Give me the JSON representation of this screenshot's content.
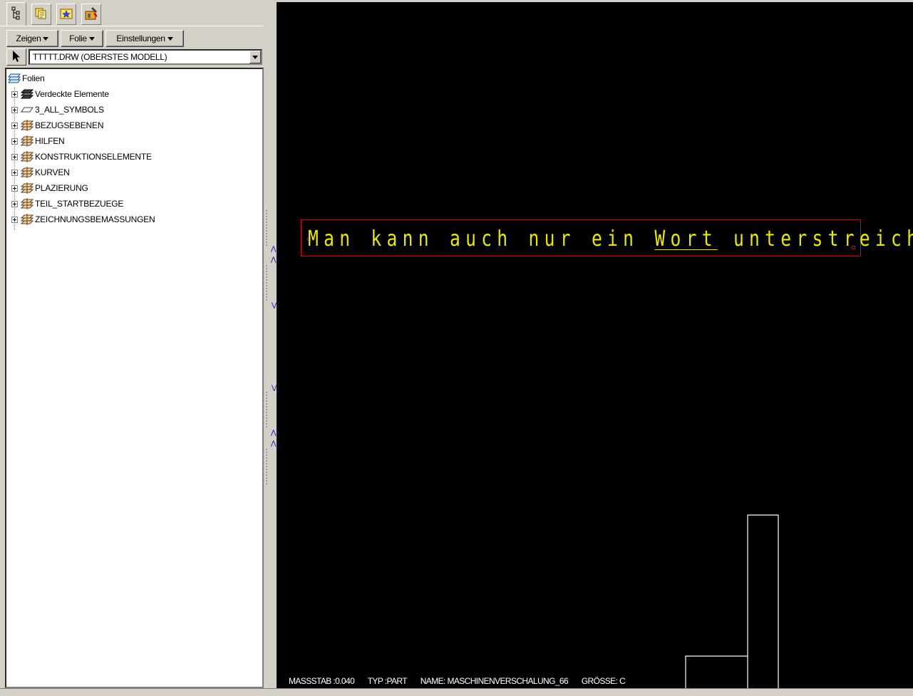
{
  "toolbar_tabs": [
    {
      "icon": "model-tree-icon"
    },
    {
      "icon": "folder-pages-icon"
    },
    {
      "icon": "favorites-star-icon"
    },
    {
      "icon": "toolbox-icon"
    }
  ],
  "menus": {
    "zeigen": "Zeigen",
    "folie": "Folie",
    "einstellungen": "Einstellungen"
  },
  "model_select": {
    "value": "TTTTT.DRW (OBERSTES MODELL)"
  },
  "tree": {
    "root": "Folien",
    "items": [
      {
        "label": "Verdeckte Elemente",
        "icon": "hidden-layers-icon"
      },
      {
        "label": "3_ALL_SYMBOLS",
        "icon": "plane-layer-icon"
      },
      {
        "label": "BEZUGSEBENEN",
        "icon": "layer-stack-icon"
      },
      {
        "label": "HILFEN",
        "icon": "layer-stack-icon"
      },
      {
        "label": "KONSTRUKTIONSELEMENTE",
        "icon": "layer-stack-icon"
      },
      {
        "label": "KURVEN",
        "icon": "layer-stack-icon"
      },
      {
        "label": "PLAZIERUNG",
        "icon": "layer-stack-icon"
      },
      {
        "label": "TEIL_STARTBEZUEGE",
        "icon": "layer-stack-icon"
      },
      {
        "label": "ZEICHNUNGSBEMASSUNGEN",
        "icon": "layer-stack-icon"
      }
    ]
  },
  "drawing": {
    "note_before": "Man kann auch nur ein ",
    "note_underlined": "Wort",
    "note_after": " unterstreichen",
    "note_color": "#e8e800",
    "frame_color": "#e00000",
    "background": "#000000"
  },
  "status": {
    "scale": "MASSSTAB :0.040",
    "type": "TYP :PART",
    "name": "NAME: MASCHINENVERSCHALUNG_66",
    "size": "GRÖSSE: C"
  }
}
